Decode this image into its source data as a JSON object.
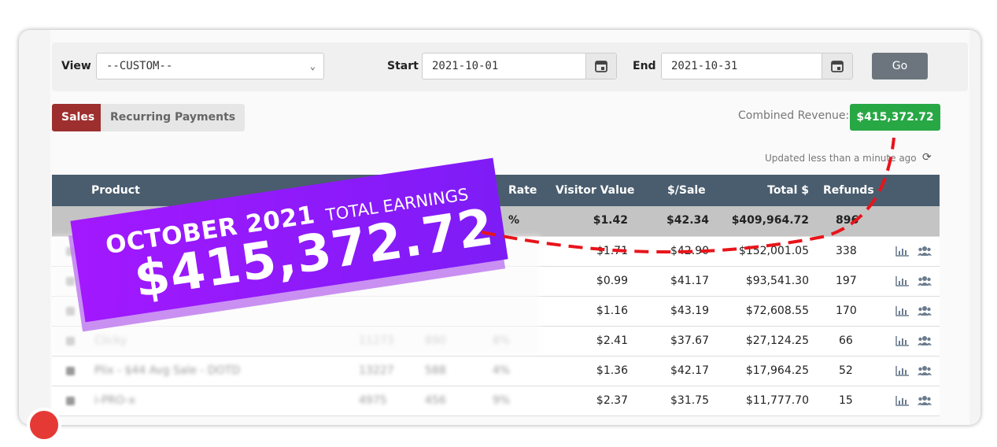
{
  "filter": {
    "view_label": "View",
    "view_value": "--CUSTOM--",
    "start_label": "Start",
    "start_value": "2021-10-01",
    "end_label": "End",
    "end_value": "2021-10-31",
    "go_label": "Go"
  },
  "tabs": [
    {
      "label": "Sales"
    },
    {
      "label": "Recurring Payments"
    }
  ],
  "combined_revenue_label": "Combined Revenue:",
  "combined_revenue_value": "$415,372.72",
  "updated_text": "Updated less than a minute ago",
  "table": {
    "headers": {
      "product": "Product",
      "rate": "Rate",
      "visitor_value": "Visitor Value",
      "per_sale": "$/Sale",
      "total": "Total $",
      "refunds": "Refunds"
    },
    "total_row": {
      "rate": "%",
      "visitor_value": "$1.42",
      "per_sale": "$42.34",
      "total": "$409,964.72",
      "refunds": "896"
    },
    "rows": [
      {
        "product": "",
        "visits": "",
        "sales": "",
        "rate": "",
        "visitor_value": "$1.71",
        "per_sale": "$42.90",
        "total": "$152,001.05",
        "refunds": "338"
      },
      {
        "product": "",
        "visits": "",
        "sales": "",
        "rate": "",
        "visitor_value": "$0.99",
        "per_sale": "$41.17",
        "total": "$93,541.30",
        "refunds": "197"
      },
      {
        "product": "",
        "visits": "",
        "sales": "",
        "rate": "",
        "visitor_value": "$1.16",
        "per_sale": "$43.19",
        "total": "$72,608.55",
        "refunds": "170"
      },
      {
        "product": "",
        "visits": "",
        "sales": "",
        "rate": "",
        "visitor_value": "$2.41",
        "per_sale": "$37.67",
        "total": "$27,124.25",
        "refunds": "66"
      },
      {
        "product": "",
        "visits": "",
        "sales": "",
        "rate": "",
        "visitor_value": "$1.36",
        "per_sale": "$42.17",
        "total": "$17,964.25",
        "refunds": "52"
      },
      {
        "product": "",
        "visits": "",
        "sales": "",
        "rate": "",
        "visitor_value": "$2.37",
        "per_sale": "$31.75",
        "total": "$11,777.70",
        "refunds": "15"
      }
    ]
  },
  "banner": {
    "line1_bold": "OCTOBER 2021",
    "line1_light": "TOTAL EARNINGS",
    "amount": "$415,372.72"
  },
  "colors": {
    "sales_tab": "#9e2f2f",
    "revenue_badge": "#28a745",
    "table_header": "#4a5d6e",
    "banner_purple": "#a318ff",
    "arrow_red": "#e8141b"
  },
  "icons": {
    "chart": "bar-chart-icon",
    "users": "users-icon",
    "calendar": "calendar-icon",
    "refresh": "refresh-icon"
  }
}
